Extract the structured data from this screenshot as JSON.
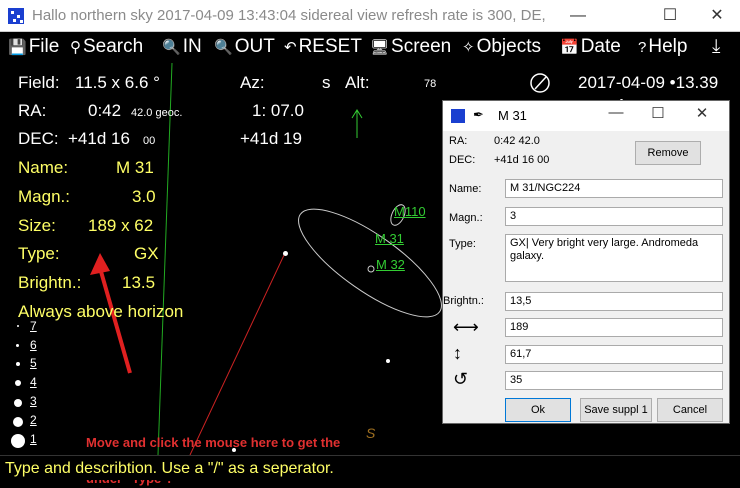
{
  "titlebar": {
    "title": "Hallo northern sky   2017-04-09  13:43:04   sidereal view   refresh rate is 300,   DE,  ",
    "minimize": "—",
    "maximize": "☐",
    "close": "✕"
  },
  "menu": {
    "file": "File",
    "search": "Search",
    "in": "IN",
    "out": "OUT",
    "reset": "RESET",
    "screen": "Screen",
    "objects": "Objects",
    "date": "Date",
    "help": "Help"
  },
  "sky": {
    "field_label": "Field:",
    "field_value": "11.5  x   6.6 °",
    "az_label": "Az:",
    "az_s": "s",
    "alt_label": "Alt:",
    "alt_value": "78",
    "datetime": "2017-04-09 •13.39",
    "ra_label": "RA:",
    "ra_value": "0:42",
    "ra_small": "42.0 geoc.",
    "ra_right": "1: 07.0",
    "dec_label": "DEC:",
    "dec_value": "+41d 16",
    "dec_small": "00",
    "dec_right": "+41d 19",
    "name_label": "Name:",
    "name_value": "M 31",
    "magn_label": "Magn.:",
    "magn_value": "3.0",
    "size_label": "Size:",
    "size_value": "189 x 62",
    "type_label": "Type:",
    "type_value": "GX",
    "brightn_label": "Brightn.:",
    "brightn_value": "13.5",
    "horizon_text": "Always above horizon",
    "mag_scale": [
      "7",
      "6",
      "5",
      "4",
      "3",
      "2",
      "1"
    ],
    "obj_m110": "M110",
    "obj_m31": "M 31",
    "obj_m32": "M 32",
    "south_marker": "S",
    "note": "Move and click the mouse here to get the supplement entry edit menu. A log could be kept under \"Type\"."
  },
  "dialog": {
    "title": "M 31",
    "ra_label": "RA:",
    "ra_value": "0:42 42.0",
    "dec_label": "DEC:",
    "dec_value": "+41d 16 00",
    "remove": "Remove",
    "name_label": "Name:",
    "name_value": "M 31/NGC224",
    "magn_label": "Magn.:",
    "magn_value": "3",
    "type_label": "Type:",
    "type_value": "GX| Very bright very large. Andromeda galaxy.",
    "brightn_label": "Brightn.:",
    "brightn_value": "13,5",
    "width_value": "189",
    "height_value": "61,7",
    "angle_value": "35",
    "ok": "Ok",
    "save": "Save suppl 1",
    "cancel": "Cancel",
    "width_glyph": "⟷",
    "height_glyph": "↕",
    "angle_glyph": "↺"
  },
  "status": {
    "text": "Type and describtion. Use a \"/\"  as a seperator."
  },
  "colors": {
    "sky_background": "#000000",
    "info_text": "#ffff66",
    "object_label": "#33cc33",
    "annotation": "#e03030"
  }
}
